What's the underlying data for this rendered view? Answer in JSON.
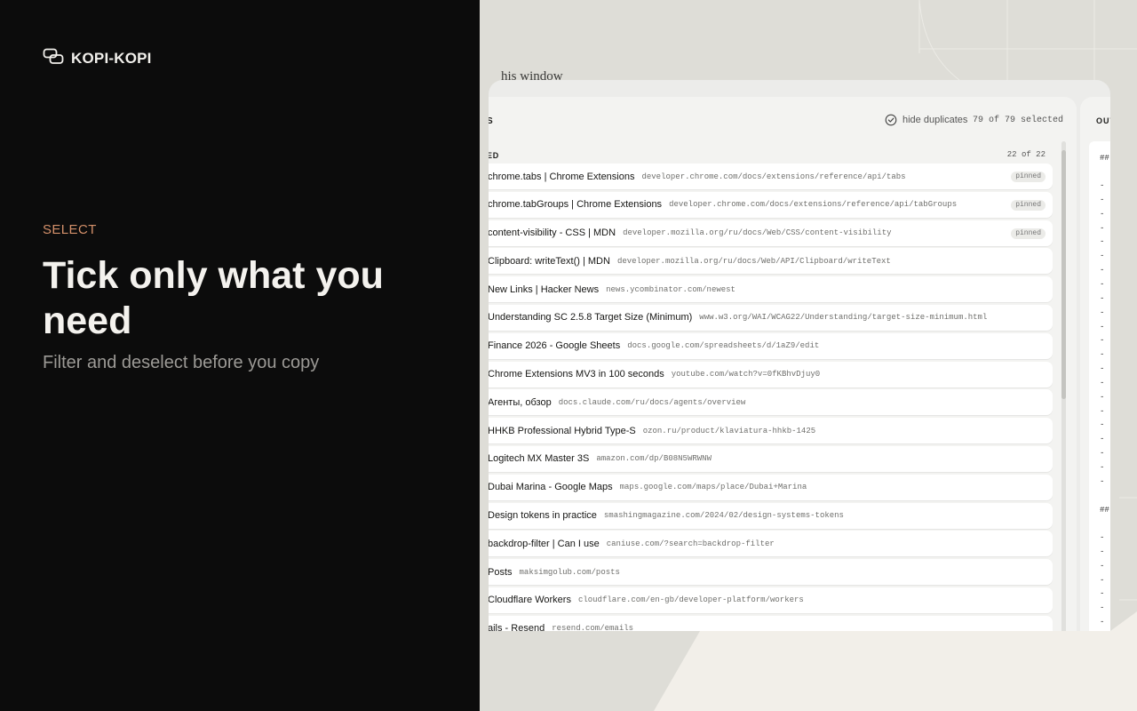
{
  "brand": {
    "name": "KOPI-KOPI",
    "icon": "copy-links-icon"
  },
  "hero": {
    "eyebrow": "SELECT",
    "headline": "Tick only what you need",
    "subline": "Filter and deselect before you copy"
  },
  "app": {
    "caption": "his window",
    "toolbar": {
      "title": "S",
      "dedupe_label": "hide duplicates",
      "dedupe_checked": true,
      "selected_count": "79 of 79 selected"
    },
    "group": {
      "title": "ED",
      "count": "22 of 22"
    },
    "tabs": [
      {
        "title": "chrome.tabs | Chrome Extensions",
        "url": "developer.chrome.com/docs/extensions/reference/api/tabs",
        "badge": "pinned"
      },
      {
        "title": "chrome.tabGroups | Chrome Extensions",
        "url": "developer.chrome.com/docs/extensions/reference/api/tabGroups",
        "badge": "pinned"
      },
      {
        "title": "content-visibility - CSS | MDN",
        "url": "developer.mozilla.org/ru/docs/Web/CSS/content-visibility",
        "badge": "pinned"
      },
      {
        "title": "Clipboard: writeText() | MDN",
        "url": "developer.mozilla.org/ru/docs/Web/API/Clipboard/writeText",
        "badge": ""
      },
      {
        "title": "New Links | Hacker News",
        "url": "news.ycombinator.com/newest",
        "badge": ""
      },
      {
        "title": "Understanding SC 2.5.8 Target Size (Minimum)",
        "url": "www.w3.org/WAI/WCAG22/Understanding/target-size-minimum.html",
        "badge": ""
      },
      {
        "title": "Finance 2026 - Google Sheets",
        "url": "docs.google.com/spreadsheets/d/1aZ9/edit",
        "badge": ""
      },
      {
        "title": "Chrome Extensions MV3 in 100 seconds",
        "url": "youtube.com/watch?v=0fKBhvDjuy0",
        "badge": ""
      },
      {
        "title": "Агенты, обзор",
        "url": "docs.claude.com/ru/docs/agents/overview",
        "badge": ""
      },
      {
        "title": "HHKB Professional Hybrid Type-S",
        "url": "ozon.ru/product/klaviatura-hhkb-1425",
        "badge": ""
      },
      {
        "title": "Logitech MX Master 3S",
        "url": "amazon.com/dp/B08N5WRWNW",
        "badge": ""
      },
      {
        "title": "Dubai Marina - Google Maps",
        "url": "maps.google.com/maps/place/Dubai+Marina",
        "badge": ""
      },
      {
        "title": "Design tokens in practice",
        "url": "smashingmagazine.com/2024/02/design-systems-tokens",
        "badge": ""
      },
      {
        "title": "backdrop-filter | Can I use",
        "url": "caniuse.com/?search=backdrop-filter",
        "badge": ""
      },
      {
        "title": "Posts",
        "url": "maksimgolub.com/posts",
        "badge": ""
      },
      {
        "title": "Cloudflare Workers",
        "url": "cloudflare.com/en-gb/developer-platform/workers",
        "badge": ""
      },
      {
        "title": "ails - Resend",
        "url": "resend.com/emails",
        "badge": ""
      }
    ],
    "output": {
      "title": "OUT",
      "heading_marker": "##",
      "line_marker": "-"
    }
  },
  "colors": {
    "left_bg": "#0c0c0c",
    "eyebrow": "#d4906a",
    "right_bg": "#deddd7",
    "bottom_light": "#f2efe9"
  }
}
